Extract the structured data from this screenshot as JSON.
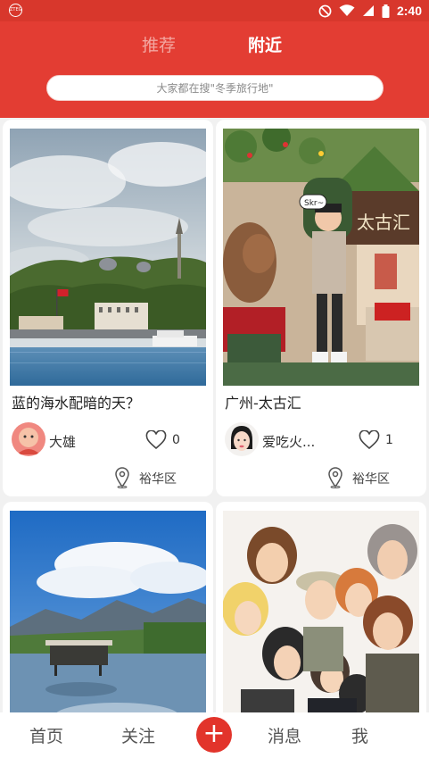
{
  "status_bar": {
    "app_badge": "ZTEG",
    "time": "2:40"
  },
  "header": {
    "tabs": [
      {
        "label": "推荐",
        "active": false
      },
      {
        "label": "附近",
        "active": true
      }
    ],
    "search": {
      "placeholder": "大家都在搜\"冬季旅行地\""
    }
  },
  "posts": [
    {
      "title": "蓝的海水配暗的天？",
      "user": "大雄",
      "likes": "0",
      "location": "裕华区",
      "image": "istanbul-coastline-photo"
    },
    {
      "title": "广州-太古汇",
      "user": "爱吃火...",
      "likes": "1",
      "location": "裕华区",
      "image": "christmas-mall-photo",
      "sign_text": "太古汇",
      "bubble_text": "Skr~"
    },
    {
      "image": "lake-mountain-photo"
    },
    {
      "image": "anime-characters-illustration"
    }
  ],
  "bottom_nav": {
    "items": [
      "首页",
      "关注",
      "消息",
      "我"
    ],
    "add_icon": "plus-icon"
  },
  "colors": {
    "primary": "#e33d33",
    "status_bar": "#d8372c",
    "inactive_tab": "#f3a6a0"
  }
}
